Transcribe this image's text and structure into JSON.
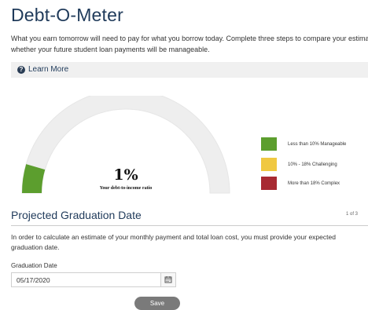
{
  "page": {
    "title": "Debt-O-Meter",
    "intro": "What you earn tomorrow will need to pay for what you borrow today. Complete three steps to compare your estimate whether your future student loan payments will be manageable."
  },
  "learn_more": {
    "label": "Learn More",
    "icon": "question-circle-icon"
  },
  "gauge": {
    "value_text": "1%",
    "value_fraction": 0.01,
    "caption": "Your debt-to-income ratio",
    "fill_color": "#5c9e2e",
    "track_color": "#eeeeee"
  },
  "legend": [
    {
      "label": "Less than 10% Manageable",
      "color": "#5c9e2e"
    },
    {
      "label": "10% - 18% Challenging",
      "color": "#f0c841"
    },
    {
      "label": "More than 18% Complex",
      "color": "#a82a32"
    }
  ],
  "section": {
    "title": "Projected Graduation Date",
    "step": "1 of 3",
    "description": "In order to calculate an estimate of your monthly payment and total loan cost, you must provide your expected graduation date."
  },
  "graduation_date": {
    "label": "Graduation Date",
    "value": "05/17/2020",
    "icon": "calendar-icon"
  },
  "save": {
    "label": "Save"
  }
}
